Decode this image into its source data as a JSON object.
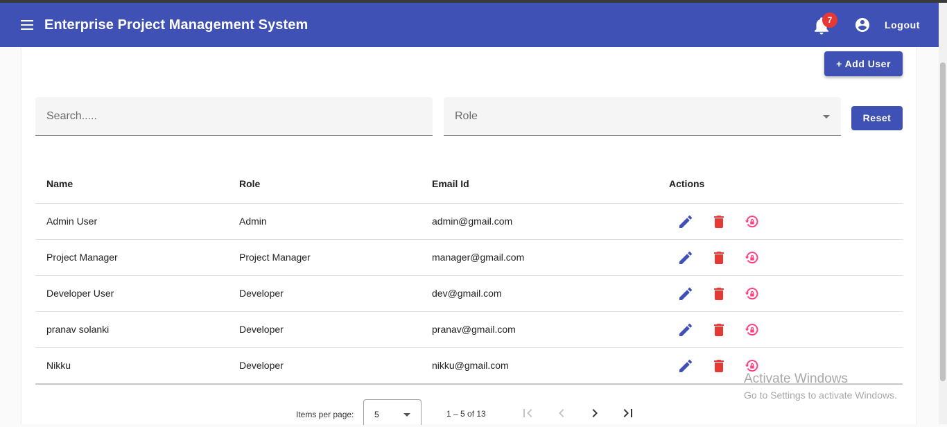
{
  "header": {
    "title": "Enterprise Project Management System",
    "notification_count": "7",
    "logout_label": "Logout",
    "bg_color": "#3f51b5",
    "icons": [
      "menu-icon",
      "bell-icon",
      "account-circle-icon"
    ]
  },
  "toolbar": {
    "add_user_label": "+ Add User"
  },
  "filters": {
    "search_placeholder": "Search.....",
    "role_placeholder": "Role",
    "reset_label": "Reset"
  },
  "table": {
    "columns": [
      "Name",
      "Role",
      "Email Id",
      "Actions"
    ],
    "rows": [
      {
        "name": "Admin User",
        "role": "Admin",
        "email": "admin@gmail.com"
      },
      {
        "name": "Project Manager",
        "role": "Project Manager",
        "email": "manager@gmail.com"
      },
      {
        "name": "Developer User",
        "role": "Developer",
        "email": "dev@gmail.com"
      },
      {
        "name": "pranav solanki",
        "role": "Developer",
        "email": "pranav@gmail.com"
      },
      {
        "name": "Nikku",
        "role": "Developer",
        "email": "nikku@gmail.com"
      }
    ],
    "action_icons": [
      "edit-icon",
      "delete-icon",
      "lock-reset-icon"
    ],
    "action_colors": {
      "edit": "#3f51b5",
      "delete": "#e53935",
      "reset": "#ff4081"
    }
  },
  "paginator": {
    "items_per_page_label": "Items per page:",
    "items_per_page_value": "5",
    "range_label": "1 – 5 of 13"
  },
  "watermark": {
    "line1": "Activate Windows",
    "line2": "Go to Settings to activate Windows."
  }
}
